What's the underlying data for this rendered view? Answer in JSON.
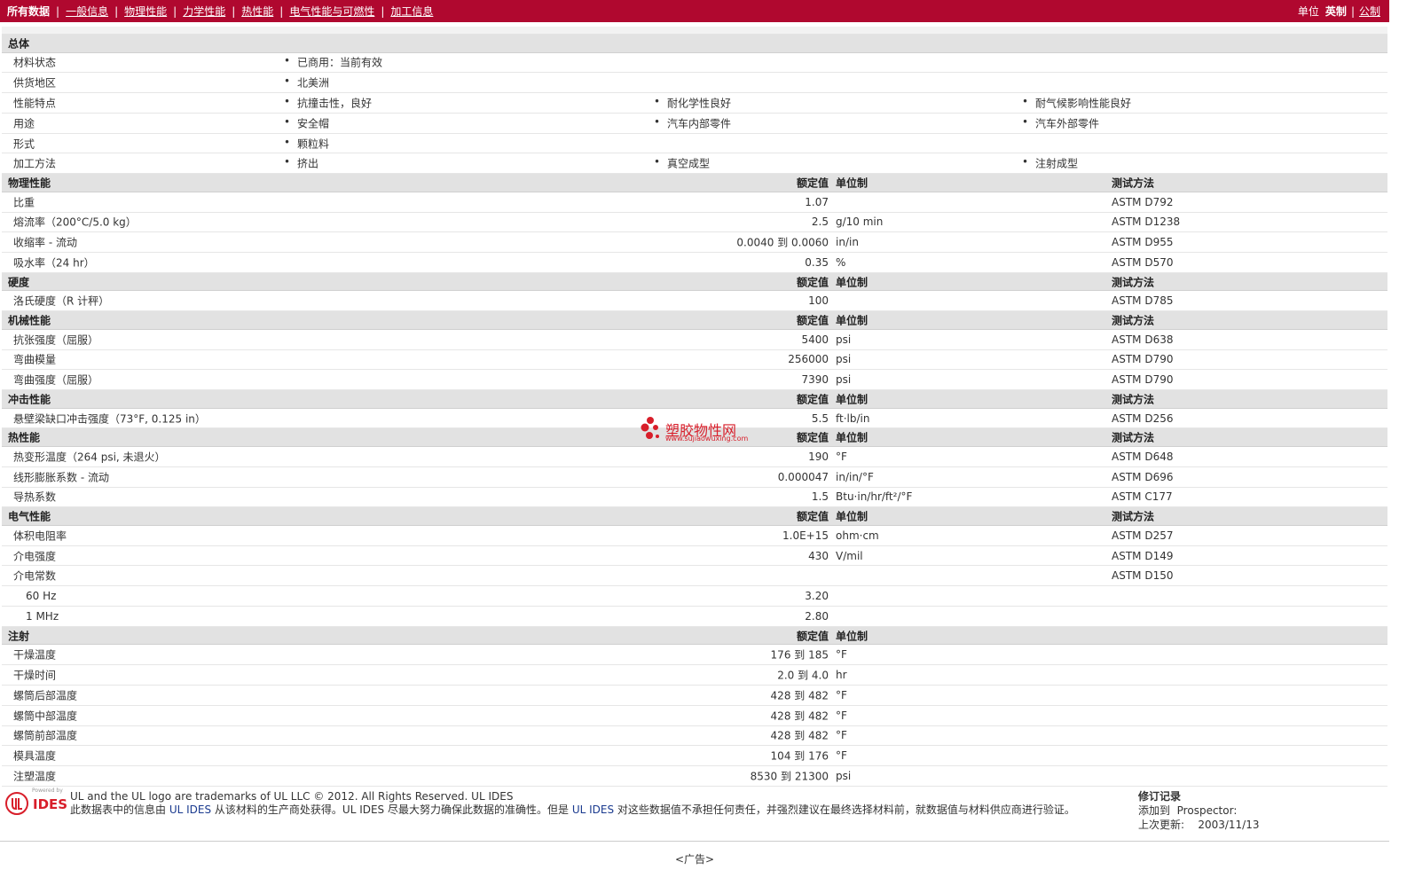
{
  "nav": {
    "items": [
      {
        "label": "所有数据",
        "current": true
      },
      {
        "label": "一般信息",
        "current": false
      },
      {
        "label": "物理性能",
        "current": false
      },
      {
        "label": "力学性能",
        "current": false
      },
      {
        "label": "热性能",
        "current": false
      },
      {
        "label": "电气性能与可燃性",
        "current": false
      },
      {
        "label": "加工信息",
        "current": false
      }
    ],
    "units_label": "单位",
    "unit_selected": "英制",
    "unit_other": "公制"
  },
  "general": {
    "title": "总体",
    "rows": [
      {
        "label": "材料状态",
        "values": [
          "已商用：当前有效"
        ]
      },
      {
        "label": "供货地区",
        "values": [
          "北美洲"
        ]
      },
      {
        "label": "性能特点",
        "values": [
          "抗撞击性，良好",
          "耐化学性良好",
          "耐气候影响性能良好"
        ]
      },
      {
        "label": "用途",
        "values": [
          "安全帽",
          "汽车内部零件",
          "汽车外部零件"
        ]
      },
      {
        "label": "形式",
        "values": [
          "颗粒料"
        ]
      },
      {
        "label": "加工方法",
        "values": [
          "挤出",
          "真空成型",
          "注射成型"
        ]
      }
    ]
  },
  "headers": {
    "value": "额定值",
    "unit": "单位制",
    "test": "测试方法"
  },
  "sections": [
    {
      "title": "物理性能",
      "has_test": true,
      "rows": [
        {
          "label": "比重",
          "value": "1.07",
          "unit": "",
          "test": "ASTM D792"
        },
        {
          "label": "熔流率（200°C/5.0 kg）",
          "value": "2.5",
          "unit": "g/10 min",
          "test": "ASTM D1238"
        },
        {
          "label": "收缩率 - 流动",
          "value": "0.0040 到  0.0060",
          "unit": "in/in",
          "test": "ASTM D955"
        },
        {
          "label": "吸水率（24 hr）",
          "value": "0.35",
          "unit": "%",
          "test": "ASTM D570"
        }
      ]
    },
    {
      "title": "硬度",
      "has_test": true,
      "rows": [
        {
          "label": "洛氏硬度（R 计秤）",
          "value": "100",
          "unit": "",
          "test": "ASTM D785"
        }
      ]
    },
    {
      "title": "机械性能",
      "has_test": true,
      "rows": [
        {
          "label": "抗张强度（屈服）",
          "value": "5400",
          "unit": "psi",
          "test": "ASTM D638"
        },
        {
          "label": "弯曲模量",
          "value": "256000",
          "unit": "psi",
          "test": "ASTM D790"
        },
        {
          "label": "弯曲强度（屈服）",
          "value": "7390",
          "unit": "psi",
          "test": "ASTM D790"
        }
      ]
    },
    {
      "title": "冲击性能",
      "has_test": true,
      "rows": [
        {
          "label": "悬壁梁缺口冲击强度（73°F, 0.125 in）",
          "value": "5.5",
          "unit": "ft·lb/in",
          "test": "ASTM D256"
        }
      ]
    },
    {
      "title": "热性能",
      "has_test": true,
      "rows": [
        {
          "label": "热变形温度（264 psi, 未退火）",
          "value": "190",
          "unit": "°F",
          "test": "ASTM D648"
        },
        {
          "label": "线形膨胀系数  - 流动",
          "value": "0.000047",
          "unit": "in/in/°F",
          "test": "ASTM D696"
        },
        {
          "label": "导热系数",
          "value": "1.5",
          "unit": "Btu·in/hr/ft²/°F",
          "test": "ASTM C177"
        }
      ]
    },
    {
      "title": "电气性能",
      "has_test": true,
      "rows": [
        {
          "label": "体积电阻率",
          "value": "1.0E+15",
          "unit": "ohm·cm",
          "test": "ASTM D257"
        },
        {
          "label": "介电强度",
          "value": "430",
          "unit": "V/mil",
          "test": "ASTM D149"
        },
        {
          "label": "介电常数",
          "value": "",
          "unit": "",
          "test": "ASTM D150"
        },
        {
          "label": "60 Hz",
          "value": "3.20",
          "unit": "",
          "test": "",
          "indent": true
        },
        {
          "label": "1 MHz",
          "value": "2.80",
          "unit": "",
          "test": "",
          "indent": true
        }
      ]
    },
    {
      "title": "注射",
      "has_test": false,
      "rows": [
        {
          "label": "干燥温度",
          "value": "176 到   185",
          "unit": "°F",
          "test": ""
        },
        {
          "label": "干燥时间",
          "value": "2.0 到   4.0",
          "unit": "hr",
          "test": ""
        },
        {
          "label": "螺筒后部温度",
          "value": "428 到   482",
          "unit": "°F",
          "test": ""
        },
        {
          "label": "螺筒中部温度",
          "value": "428 到   482",
          "unit": "°F",
          "test": ""
        },
        {
          "label": "螺筒前部温度",
          "value": "428 到   482",
          "unit": "°F",
          "test": ""
        },
        {
          "label": "模具温度",
          "value": "104 到   176",
          "unit": "°F",
          "test": ""
        },
        {
          "label": "注塑温度",
          "value": "8530 到  21300",
          "unit": "psi",
          "test": ""
        }
      ]
    }
  ],
  "watermark": {
    "text": "塑胶物性网",
    "url": "www.sujiaowuxing.com"
  },
  "footer": {
    "logo_small": "Powered by",
    "logo_text": "IDES",
    "trademark": "UL and the UL logo are trademarks of UL LLC © 2012. All Rights Reserved. UL IDES",
    "notice_a": "此数据表中的信息由 ",
    "notice_b": "UL IDES",
    "notice_c": " 从该材料的生产商处获得。UL IDES 尽最大努力确保此数据的准确性。但是 ",
    "notice_d": "UL IDES",
    "notice_e": " 对这些数据值不承担任何责任，并强烈建议在最终选择材料前，就数据值与材料供应商进行验证。",
    "rev_title": "修订记录",
    "rev_added_label": "添加到",
    "rev_added_value": "Prospector:",
    "rev_updated_label": "上次更新:",
    "rev_updated_value": "2003/11/13"
  },
  "ad_label": "<广告>"
}
